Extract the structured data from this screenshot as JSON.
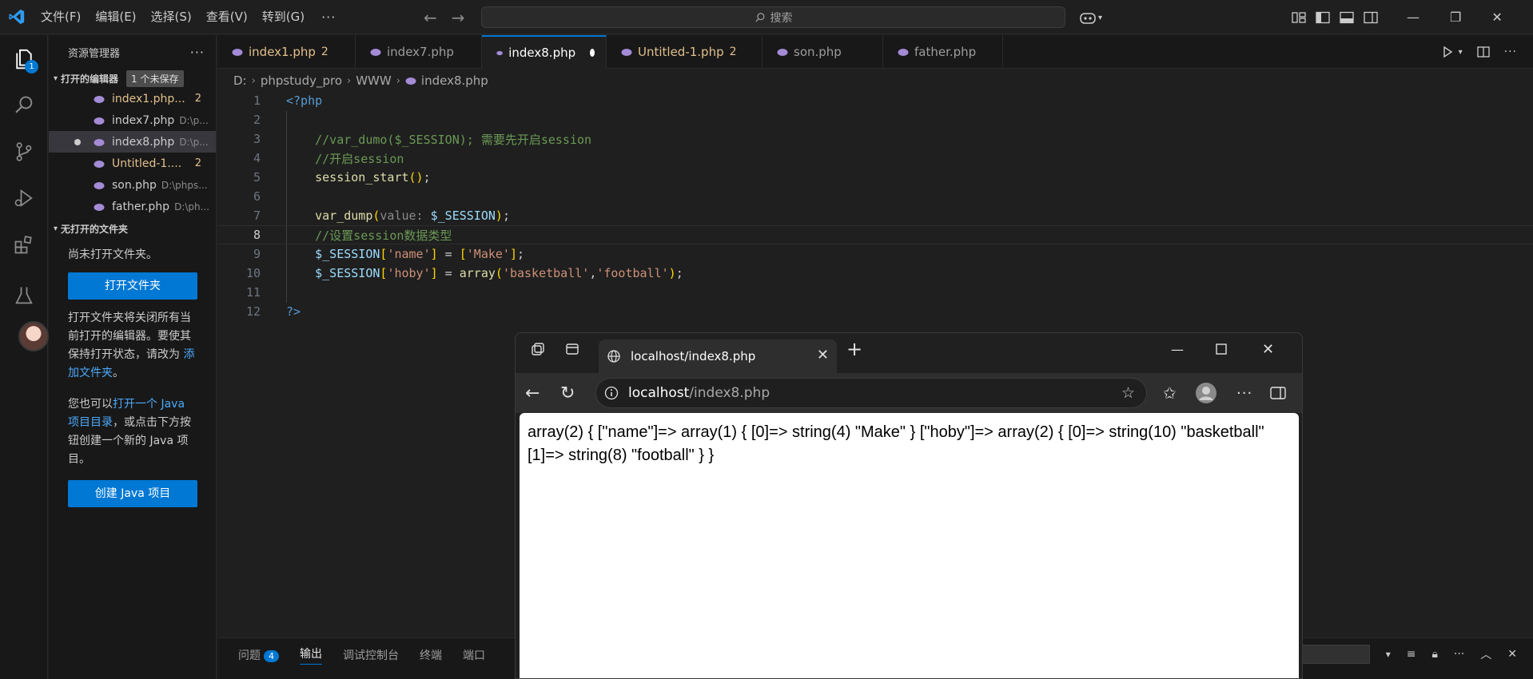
{
  "titlebar": {
    "menu": [
      "文件(F)",
      "编辑(E)",
      "选择(S)",
      "查看(V)",
      "转到(G)"
    ],
    "more": "···",
    "search_label": "搜索"
  },
  "activity": {
    "explorer_badge": "1"
  },
  "sidebar": {
    "title": "资源管理器",
    "more": "···",
    "open_editors_title": "打开的编辑器",
    "unsaved_badge": "1 个未保存",
    "open_editors": [
      {
        "name": "index1.php...",
        "path": "",
        "count": "2",
        "modified": true
      },
      {
        "name": "index7.php",
        "path": "D:\\p...",
        "count": "",
        "modified": false
      },
      {
        "name": "index8.php",
        "path": "D:\\p...",
        "count": "",
        "modified": false
      },
      {
        "name": "Untitled-1....",
        "path": "",
        "count": "2",
        "modified": true
      },
      {
        "name": "son.php",
        "path": "D:\\phps...",
        "count": "",
        "modified": false
      },
      {
        "name": "father.php",
        "path": "D:\\ph...",
        "count": "",
        "modified": false
      }
    ],
    "no_folder_title": "无打开的文件夹",
    "no_folder_text": "尚未打开文件夹。",
    "open_folder_button": "打开文件夹",
    "para1_a": "打开文件夹将关闭所有当前打开的编辑器。要使其保持打开状态，请改为 ",
    "para1_link": "添加文件夹",
    "para1_end": "。",
    "para2_a": "您也可以",
    "para2_link": "打开一个 Java 项目目录",
    "para2_b": "，或点击下方按钮创建一个新的 Java 项目。",
    "create_java_button": "创建 Java 项目"
  },
  "tabs": [
    {
      "name": "index1.php",
      "count": "2",
      "modified": true,
      "active": false
    },
    {
      "name": "index7.php",
      "count": "",
      "modified": false,
      "active": false
    },
    {
      "name": "index8.php",
      "count": "",
      "modified": false,
      "active": true
    },
    {
      "name": "Untitled-1.php",
      "count": "2",
      "modified": true,
      "active": false
    },
    {
      "name": "son.php",
      "count": "",
      "modified": false,
      "active": false
    },
    {
      "name": "father.php",
      "count": "",
      "modified": false,
      "active": false
    }
  ],
  "breadcrumb": [
    "D:",
    "phpstudy_pro",
    "WWW",
    "index8.php"
  ],
  "editor": {
    "line_numbers": [
      "1",
      "2",
      "3",
      "4",
      "5",
      "6",
      "7",
      "8",
      "9",
      "10",
      "11",
      "12"
    ],
    "current_line": "8"
  },
  "panel": {
    "tabs": [
      "问题",
      "输出",
      "调试控制台",
      "终端",
      "端口"
    ],
    "problems_count": "4"
  },
  "browser": {
    "tab_title": "localhost/index8.php",
    "url_host": "localhost",
    "url_path": "/index8.php",
    "content": "array(2) { [\"name\"]=> array(1) { [0]=> string(4) \"Make\" } [\"hoby\"]=> array(2) { [0]=> string(10) \"basketball\" [1]=> string(8) \"football\" } }"
  },
  "colors": {
    "accent": "#0078d4",
    "modified": "#e2c08d",
    "editor_bg": "#1f1f1f"
  }
}
